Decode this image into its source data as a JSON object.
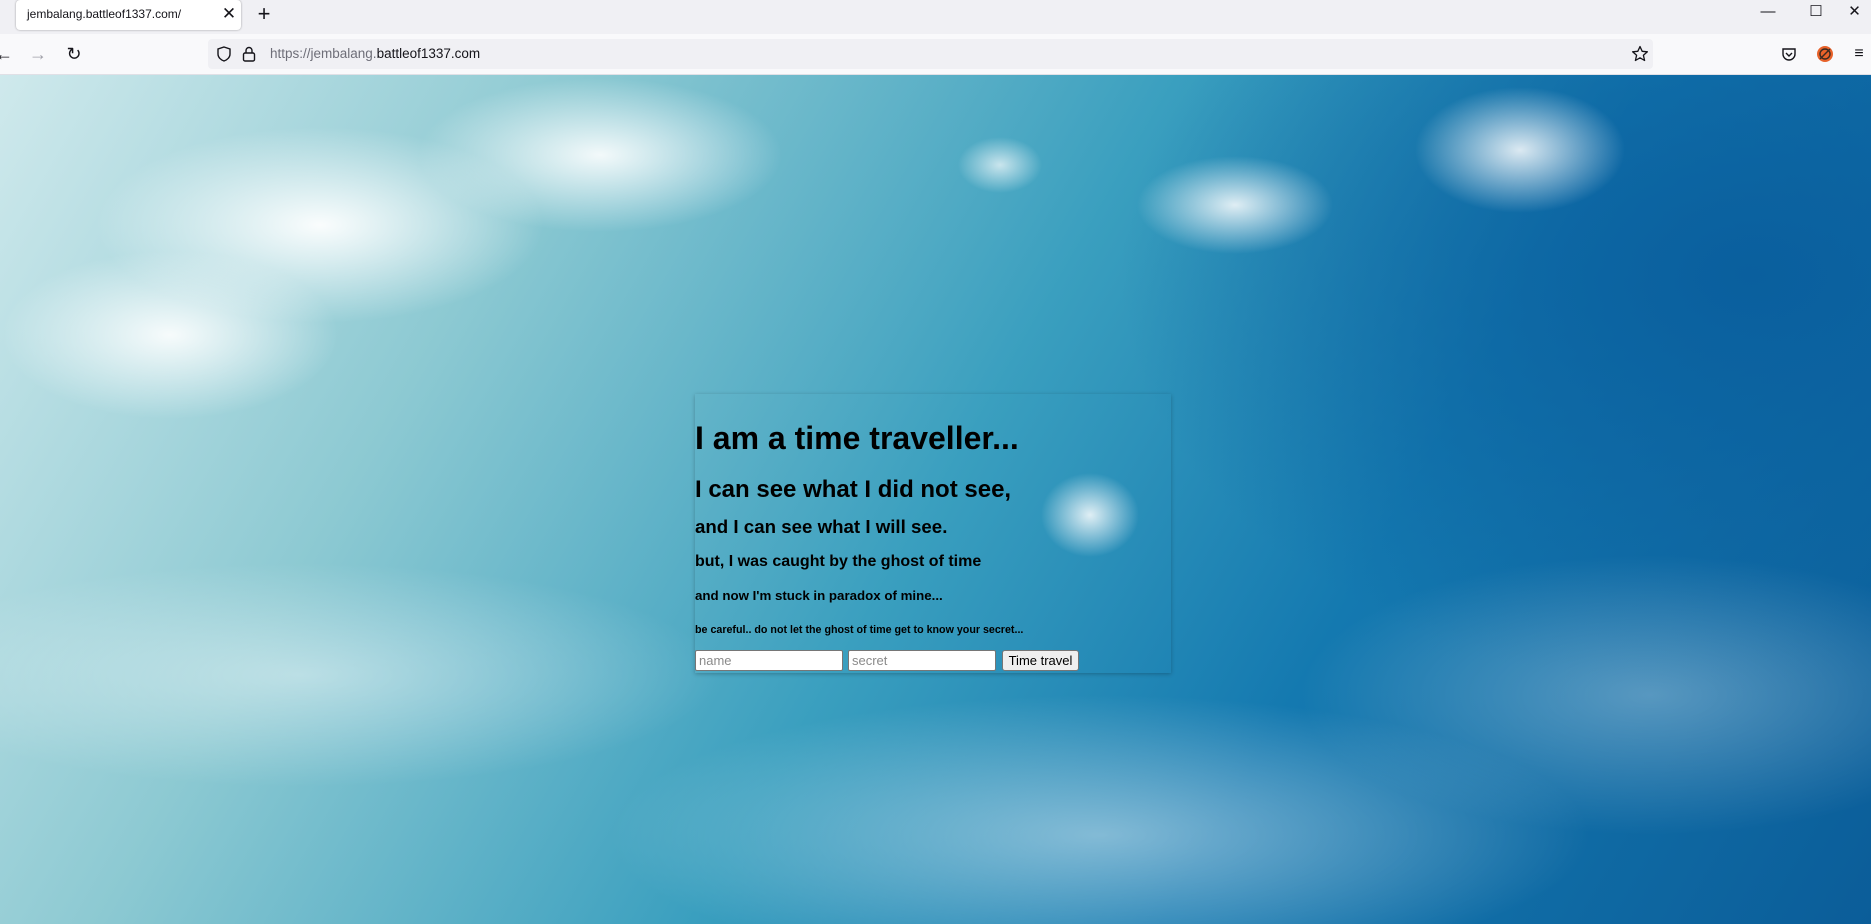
{
  "browser": {
    "tab_title": "jembalang.battleof1337.com/",
    "url_prefix": "https://jembalang.",
    "url_domain": "battleof1337.com",
    "icons": [
      "back-icon",
      "forward-icon",
      "reload-icon",
      "shield-icon",
      "lock-icon",
      "star-icon",
      "pocket-icon",
      "extension-icon",
      "menu-icon",
      "close-icon",
      "new-tab-icon",
      "minimize-icon",
      "maximize-icon"
    ]
  },
  "page": {
    "heading1": "I am a time traveller...",
    "heading2": "I can see what I did not see,",
    "heading3": "and I can see what I will see.",
    "heading4": "but, I was caught by the ghost of time",
    "heading5": "and now I'm stuck in paradox of mine...",
    "heading6": "be careful.. do not let the ghost of time get to know your secret...",
    "form": {
      "name_placeholder": "name",
      "secret_placeholder": "secret",
      "name_value": "",
      "secret_value": "",
      "submit_label": "Time travel"
    }
  }
}
